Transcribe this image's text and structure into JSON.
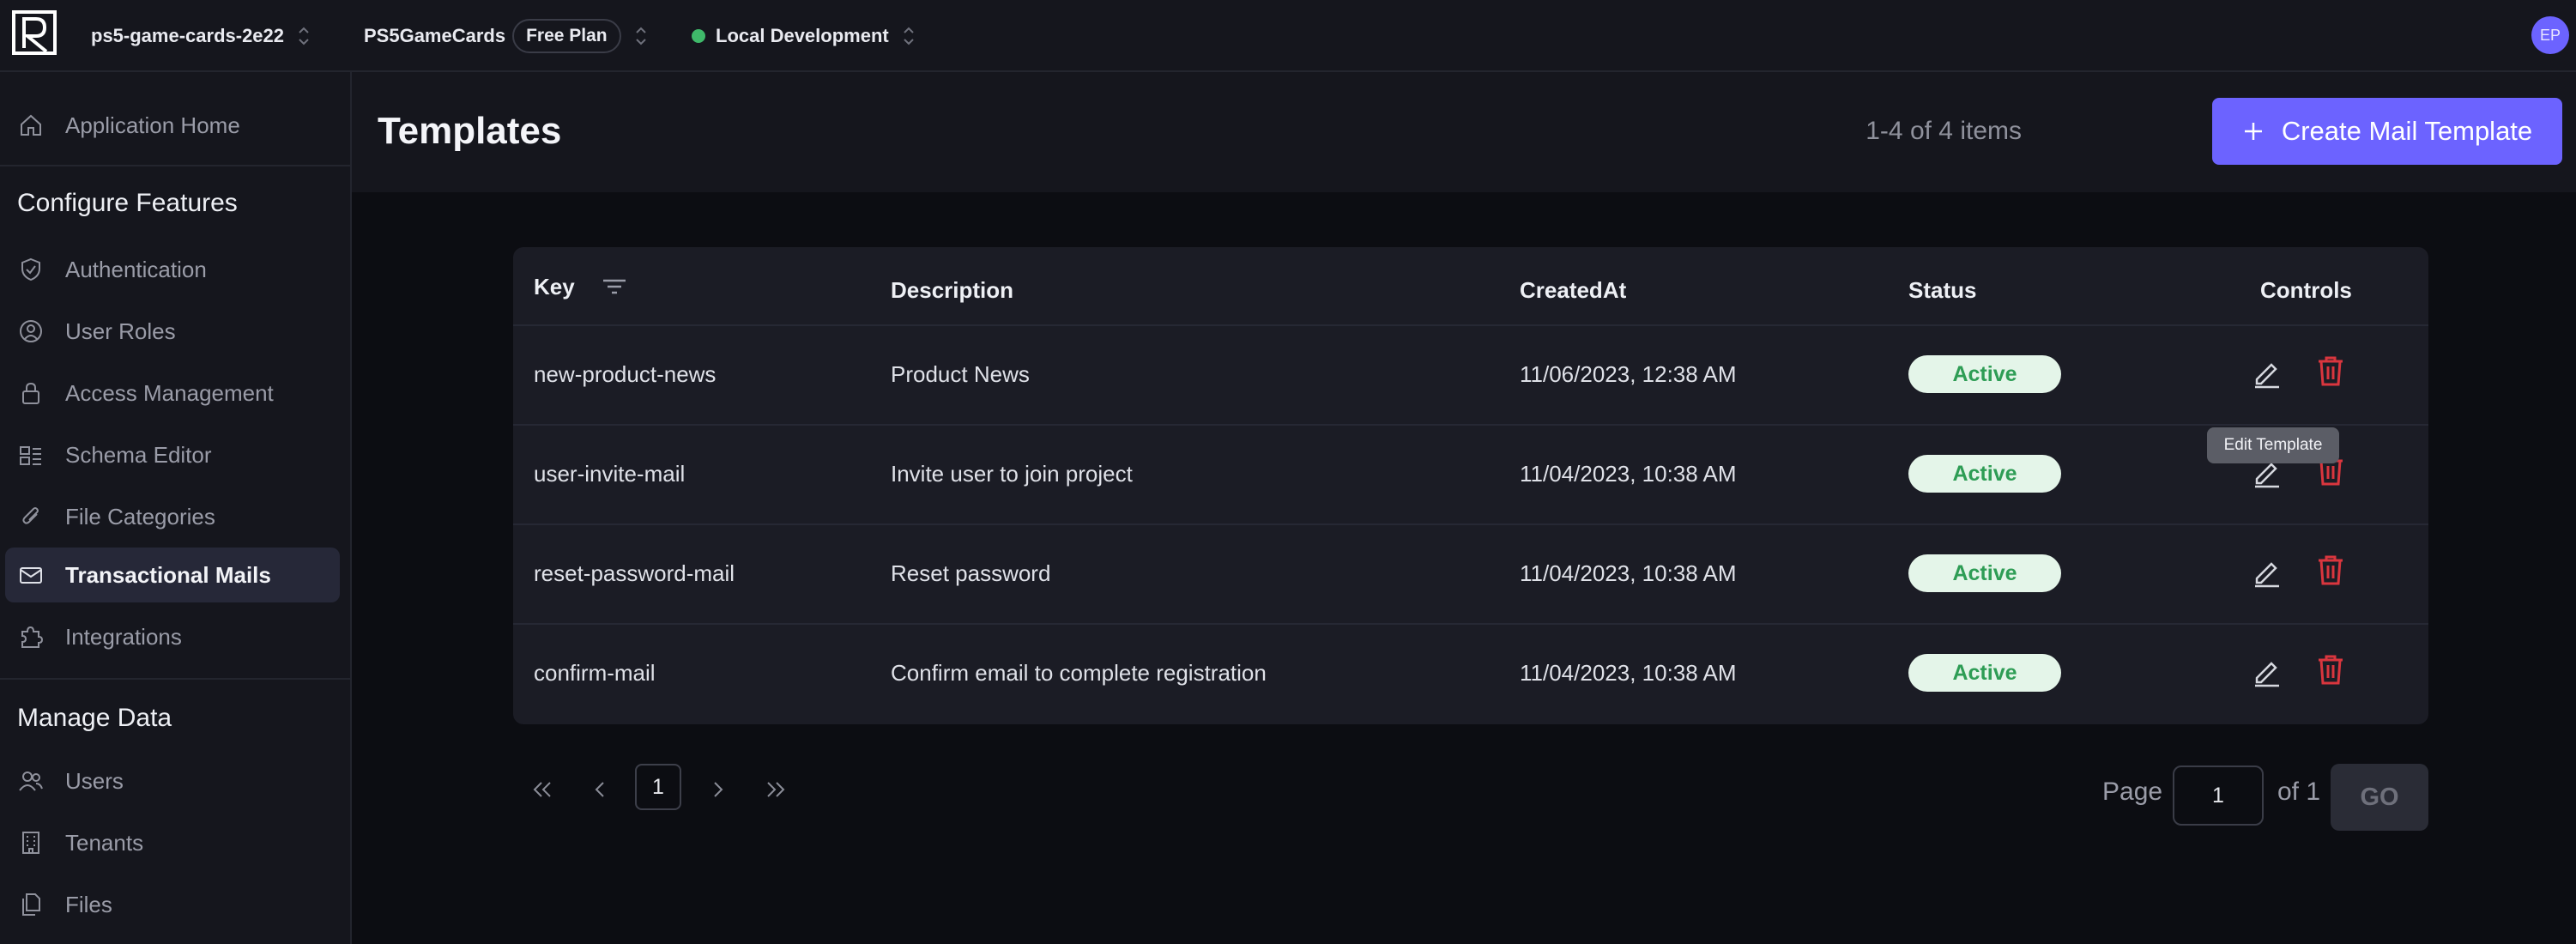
{
  "topbar": {
    "project": "ps5-game-cards-2e22",
    "org": "PS5GameCards",
    "plan": "Free Plan",
    "environment": "Local Development",
    "avatar_initials": "EP"
  },
  "sidebar": {
    "home": "Application Home",
    "section_configure": "Configure Features",
    "configure_items": [
      "Authentication",
      "User Roles",
      "Access Management",
      "Schema Editor",
      "File Categories",
      "Transactional Mails",
      "Integrations"
    ],
    "section_manage": "Manage Data",
    "manage_items": [
      "Users",
      "Tenants",
      "Files"
    ]
  },
  "header": {
    "title": "Templates",
    "count": "1-4 of 4 items",
    "create_label": "Create Mail Template"
  },
  "table": {
    "columns": [
      "Key",
      "Description",
      "CreatedAt",
      "Status",
      "Controls"
    ],
    "rows": [
      {
        "key": "new-product-news",
        "description": "Product News",
        "created": "11/06/2023, 12:38 AM",
        "status": "Active"
      },
      {
        "key": "user-invite-mail",
        "description": "Invite user to join project",
        "created": "11/04/2023, 10:38 AM",
        "status": "Active"
      },
      {
        "key": "reset-password-mail",
        "description": "Reset password",
        "created": "11/04/2023, 10:38 AM",
        "status": "Active"
      },
      {
        "key": "confirm-mail",
        "description": "Confirm email to complete registration",
        "created": "11/04/2023, 10:38 AM",
        "status": "Active"
      }
    ],
    "tooltip": "Edit Template"
  },
  "pagination": {
    "current": "1",
    "page_label": "Page",
    "page_value": "1",
    "of_label": "of 1",
    "go_label": "GO"
  },
  "colors": {
    "accent": "#6c63ff",
    "danger": "#d9363e",
    "success": "#3fb96a"
  }
}
